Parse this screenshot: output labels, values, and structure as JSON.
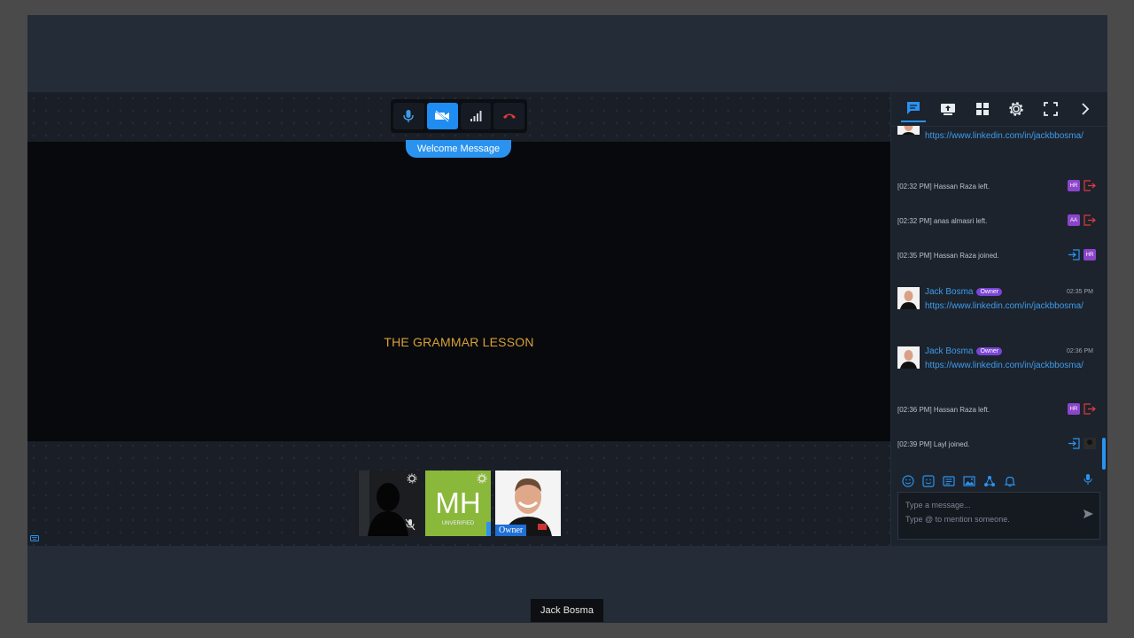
{
  "stage": {
    "lesson_title": "THE GRAMMAR LESSON",
    "welcome_label": "Welcome Message",
    "controls": [
      "microphone-icon",
      "camera-off-icon",
      "signal-icon",
      "hangup-icon"
    ]
  },
  "participants": [
    {
      "kind": "video",
      "muted": true
    },
    {
      "initials": "MH",
      "status": "UNVERIFIED",
      "color": "#8ab83b"
    },
    {
      "role": "Owner"
    }
  ],
  "panel": {
    "tabs": [
      "chat-icon",
      "screen-share-icon",
      "grid-icon",
      "settings-icon",
      "fullscreen-icon",
      "chevron-right-icon"
    ],
    "messages": {
      "link_top": "https://www.linkedin.com/in/jackbbosma/",
      "sys1": {
        "text": "[02:32 PM] Hassan Raza left.",
        "initials": "HR",
        "color": "#8b45c9"
      },
      "sys2": {
        "text": "[02:32 PM] anas almasri left.",
        "initials": "AA",
        "color": "#8b45c9"
      },
      "sys3": {
        "text": "[02:35 PM] Hassan Raza joined.",
        "initials": "HR",
        "color": "#8b45c9"
      },
      "chat1": {
        "name": "Jack Bosma",
        "role": "Owner",
        "time": "02:35 PM",
        "link": "https://www.linkedin.com/in/jackbbosma/"
      },
      "chat2": {
        "name": "Jack Bosma",
        "role": "Owner",
        "time": "02:36 PM",
        "link": "https://www.linkedin.com/in/jackbbosma/"
      },
      "sys4": {
        "text": "[02:36 PM] Hassan Raza left.",
        "initials": "HR",
        "color": "#8b45c9"
      },
      "sys5": {
        "text": "[02:39 PM] Layl joined."
      }
    },
    "input": {
      "placeholder": "Type a message...\nType @ to mention someone."
    }
  },
  "tooltip": "Jack Bosma",
  "colors": {
    "accent": "#2a93f0",
    "leave": "#e03a3a",
    "lesson": "#d9a035"
  }
}
